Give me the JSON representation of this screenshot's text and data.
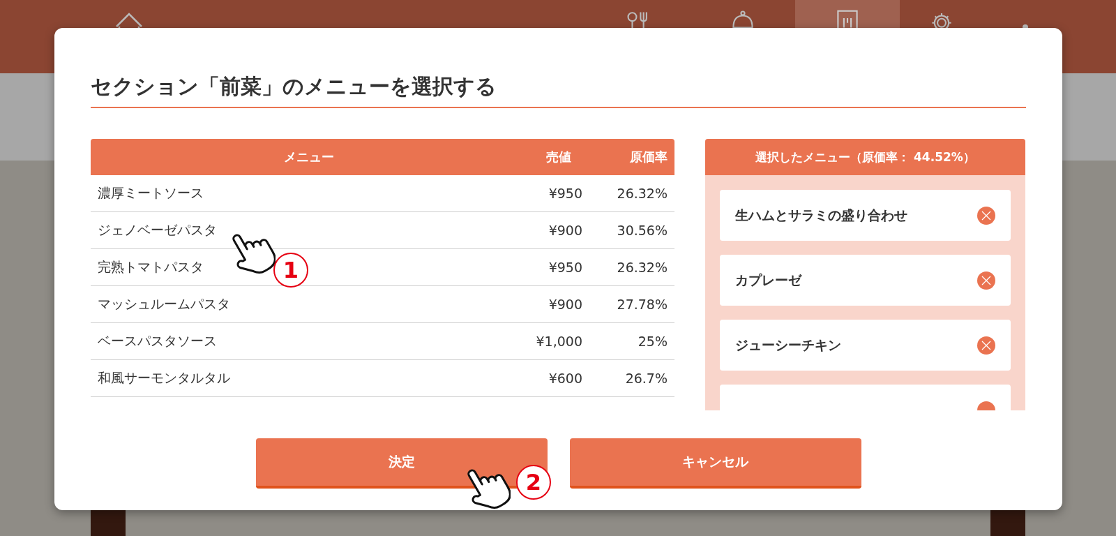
{
  "nav": {
    "tabs": [
      {
        "kind": "home",
        "selected": false
      },
      {
        "kind": "dining",
        "selected": false
      },
      {
        "kind": "service",
        "selected": false
      },
      {
        "kind": "menu",
        "selected": true
      },
      {
        "kind": "settings",
        "selected": false
      },
      {
        "kind": "more",
        "selected": false
      }
    ]
  },
  "dialog": {
    "title": "セクション「前菜」のメニューを選択する",
    "table": {
      "columns": [
        "メニュー",
        "売値",
        "原価率"
      ],
      "rows": [
        {
          "name": "濃厚ミートソース",
          "price": "¥950",
          "cost_rate": "26.32%"
        },
        {
          "name": "ジェノベーゼパスタ",
          "price": "¥900",
          "cost_rate": "30.56%"
        },
        {
          "name": "完熟トマトパスタ",
          "price": "¥950",
          "cost_rate": "26.32%"
        },
        {
          "name": "マッシュルームパスタ",
          "price": "¥900",
          "cost_rate": "27.78%"
        },
        {
          "name": "ベースパスタソース",
          "price": "¥1,000",
          "cost_rate": "25%"
        },
        {
          "name": "和風サーモンタルタル",
          "price": "¥600",
          "cost_rate": "26.7%"
        }
      ]
    },
    "selected_panel": {
      "title": "選択したメニュー（原価率：  44.52%）",
      "items": [
        {
          "name": "生ハムとサラミの盛り合わせ"
        },
        {
          "name": "カプレーゼ"
        },
        {
          "name": "ジューシーチキン"
        }
      ],
      "overflow_card": true
    },
    "buttons": [
      "決定",
      "キャンセル"
    ]
  },
  "annotations": [
    {
      "label": "1"
    },
    {
      "label": "2"
    }
  ]
}
